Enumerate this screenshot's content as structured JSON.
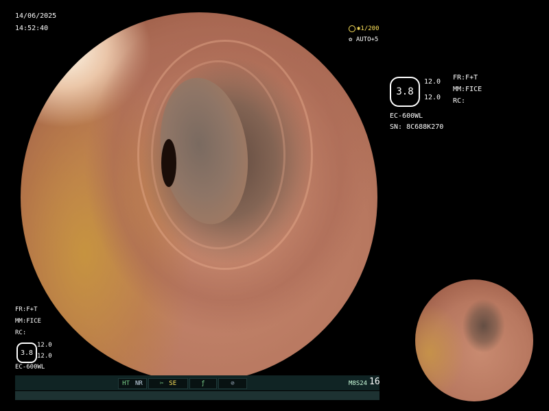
{
  "header": {
    "date": "14/06/2025",
    "time": "14:52:40"
  },
  "exposure": {
    "shutter": "1/200",
    "auto": "AUTO+5",
    "shutter_icon": "shutter-icon",
    "auto_icon": "iris-icon"
  },
  "right_panel": {
    "magnification": "3.8",
    "value1": "12.0",
    "value2": "12.0",
    "fr": "FR:F+T",
    "mm": "MM:FICE",
    "rc": "RC:",
    "scope_model": "EC-600WL",
    "serial": "SN: 8C688K270"
  },
  "left_panel": {
    "fr": "FR:F+T",
    "mm": "MM:FICE",
    "rc": "RC:",
    "magnification": "3.8",
    "value1": "12.0",
    "value2": "12.0",
    "scope_model": "EC-600WL"
  },
  "status_bar": {
    "ht": "HT",
    "nr": "NR",
    "se": "SE",
    "code": "M8S24",
    "number": "16",
    "se_icon": "scissors-icon",
    "f_icon": "slash-icon",
    "circle_icon": "record-icon"
  },
  "colors": {
    "accent_yellow": "#ffe35a",
    "status_green": "#7bd08a",
    "bar_background": "#102424"
  }
}
